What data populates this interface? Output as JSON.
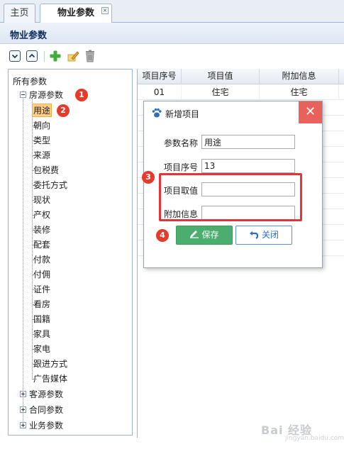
{
  "tabs": [
    {
      "label": "主页"
    },
    {
      "label": "物业参数",
      "close": "×"
    }
  ],
  "panel": {
    "title": "物业参数"
  },
  "toolbar": {
    "buttons": [
      "expand-all",
      "collapse-all",
      "add",
      "edit",
      "delete"
    ]
  },
  "tree": {
    "root": "所有参数",
    "groups": [
      {
        "label": "房源参数",
        "expanded": true
      },
      {
        "label": "客源参数",
        "expanded": false
      },
      {
        "label": "合同参数",
        "expanded": false
      },
      {
        "label": "业务参数",
        "expanded": false
      }
    ],
    "children": [
      "用途",
      "朝向",
      "类型",
      "来源",
      "包税费",
      "委托方式",
      "现状",
      "产权",
      "装修",
      "配套",
      "付款",
      "付佣",
      "证件",
      "看房",
      "国籍",
      "家具",
      "家电",
      "跟进方式",
      "广告媒体"
    ],
    "selected": "用途"
  },
  "grid": {
    "columns": [
      "项目序号",
      "项目值",
      "附加信息"
    ],
    "rows": [
      {
        "no": "01",
        "value": "住宅",
        "extra": "住宅"
      }
    ]
  },
  "dialog": {
    "title": "新增项目",
    "close": "✕",
    "fields": {
      "param_name_label": "参数名称",
      "param_name_value": "用途",
      "item_no_label": "项目序号",
      "item_no_value": "13",
      "item_value_label": "项目取值",
      "item_value_value": "",
      "extra_label": "附加信息",
      "extra_value": ""
    },
    "save_label": "保存",
    "close_label": "关闭"
  },
  "badges": [
    "1",
    "2",
    "3",
    "4"
  ],
  "colors": {
    "accent": "#4cae6e",
    "badge": "#e63a2a",
    "highlight": "#e5333a",
    "selection": "#ffd08a",
    "close_bg": "#e8615a"
  },
  "watermark": {
    "text": "Bai 经验",
    "url": "jingyan.baidu.com"
  }
}
